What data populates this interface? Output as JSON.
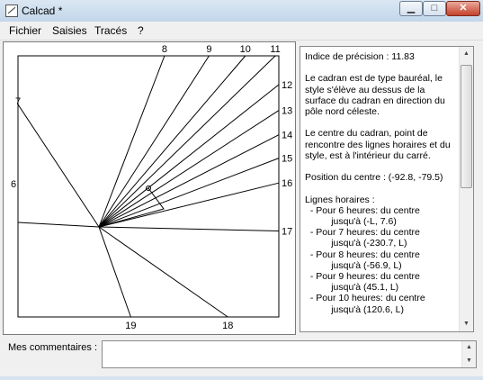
{
  "window": {
    "title": "Calcad *",
    "min_glyph": "▁",
    "max_glyph": "□",
    "close_glyph": "✕"
  },
  "menu": [
    "Fichier",
    "Saisies",
    "Tracés",
    "?"
  ],
  "dial": {
    "hours": [
      {
        "label": "7",
        "angle_deg": -123.5
      },
      {
        "label": "8",
        "angle_deg": -69.0
      },
      {
        "label": "9",
        "angle_deg": -57.2
      },
      {
        "label": "10",
        "angle_deg": -49.4
      },
      {
        "label": "11",
        "angle_deg": -44.1
      },
      {
        "label": "12",
        "angle_deg": -38.3
      },
      {
        "label": "13",
        "angle_deg": -32.9
      },
      {
        "label": "14",
        "angle_deg": -27.1
      },
      {
        "label": "15",
        "angle_deg": -20.9
      },
      {
        "label": "16",
        "angle_deg": -13.7
      },
      {
        "label": "17",
        "angle_deg": 1.3
      },
      {
        "label": "18",
        "angle_deg": 34.9
      },
      {
        "label": "19",
        "angle_deg": 70.5
      }
    ],
    "side_label": "6"
  },
  "info": {
    "lines": [
      "Indice de précision : 11.83",
      "",
      "Le cadran est de type bauréal, le",
      "style s'élève au dessus de la",
      "surface du cadran en direction du",
      "pôle nord céleste.",
      "",
      "Le centre du cadran, point de",
      "rencontre des lignes horaires et du",
      "style, est à l'intérieur du carré.",
      "",
      "Position du centre : (-92.8, -79.5)",
      "",
      "Lignes horaires :",
      "  - Pour 6 heures: du centre",
      "          jusqu'à (-L, 7.6)",
      "  - Pour 7 heures: du centre",
      "          jusqu'à (-230.7, L)",
      "  - Pour 8 heures: du centre",
      "          jusqu'à (-56.9, L)",
      "  - Pour 9 heures: du centre",
      "          jusqu'à (45.1, L)",
      "  - Pour 10 heures: du centre",
      "          jusqu'à (120.6, L)"
    ]
  },
  "comments": {
    "label": "Mes commentaires :",
    "value": ""
  }
}
